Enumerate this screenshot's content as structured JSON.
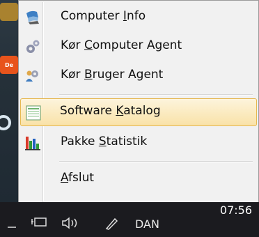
{
  "menu": {
    "items": [
      {
        "pre": "Computer ",
        "key": "I",
        "post": "nfo",
        "icon": "computer-info-icon"
      },
      {
        "pre": "Kør ",
        "key": "C",
        "post": "omputer Agent",
        "icon": "gears-icon"
      },
      {
        "pre": "Kør ",
        "key": "B",
        "post": "ruger Agent",
        "icon": "user-agent-icon"
      },
      {
        "pre": "Software ",
        "key": "K",
        "post": "atalog",
        "icon": "catalog-icon"
      },
      {
        "pre": "Pakke ",
        "key": "S",
        "post": "tatistik",
        "icon": "bar-chart-icon"
      },
      {
        "pre": "",
        "key": "A",
        "post": "fslut",
        "icon": ""
      }
    ],
    "highlighted_index": 3
  },
  "desktop": {
    "badge": "De"
  },
  "taskbar": {
    "clock": "07:56",
    "language": "DAN"
  },
  "colors": {
    "menu_bg": "#f1f1f1",
    "highlight_border": "#e6b850",
    "highlight_fill": "#f9e2a8",
    "taskbar_bg": "#1b1b1f"
  }
}
